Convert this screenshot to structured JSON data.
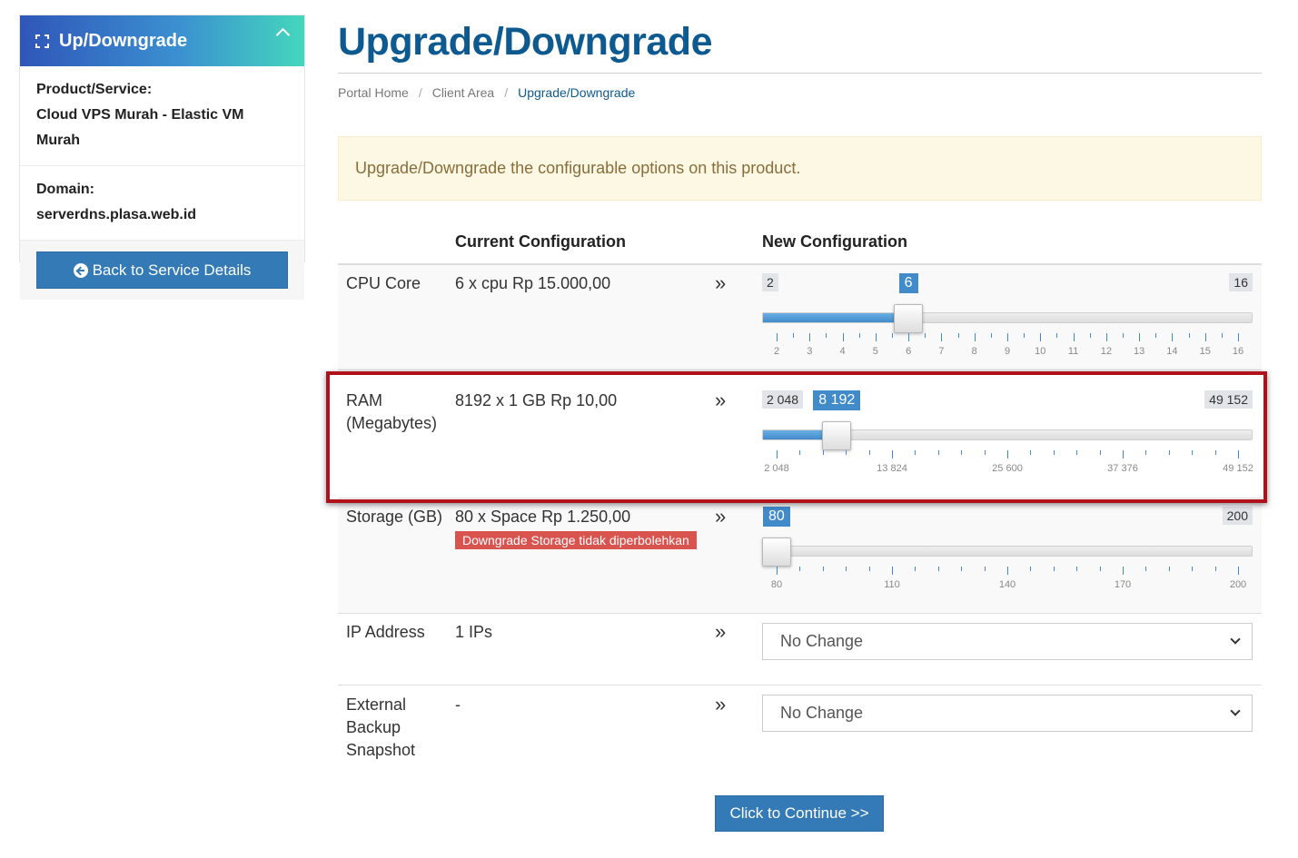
{
  "sidebar": {
    "title": "Up/Downgrade",
    "product_label": "Product/Service:",
    "product_value": "Cloud VPS Murah - Elastic VM Murah",
    "domain_label": "Domain:",
    "domain_value": "serverdns.plasa.web.id",
    "back_button": "Back to Service Details"
  },
  "page": {
    "title": "Upgrade/Downgrade",
    "breadcrumb": [
      "Portal Home",
      "Client Area",
      "Upgrade/Downgrade"
    ],
    "breadcrumb_sep": "/",
    "alert": "Upgrade/Downgrade the configurable options on this product."
  },
  "table": {
    "head_current": "Current Configuration",
    "head_new": "New Configuration",
    "arrow": "»",
    "rows": [
      {
        "label": "CPU Core",
        "current": "6 x cpu Rp 15.000,00",
        "min": "2",
        "max": "16",
        "value": "6",
        "min_num": 2,
        "max_num": 16,
        "value_num": 6,
        "tick_labels": [
          "2",
          "3",
          "4",
          "5",
          "6",
          "7",
          "8",
          "9",
          "10",
          "11",
          "12",
          "13",
          "14",
          "15",
          "16"
        ]
      },
      {
        "label": "RAM (Megabytes)",
        "current": "8192 x 1 GB Rp 10,00",
        "min": "2 048",
        "max": "49 152",
        "value": "8 192",
        "min_num": 2048,
        "max_num": 49152,
        "value_num": 8192,
        "tick_labels": [
          "2 048",
          "13 824",
          "25 600",
          "37 376",
          "49 152"
        ]
      },
      {
        "label": "Storage (GB)",
        "current": "80 x Space Rp 1.250,00",
        "warning": "Downgrade Storage tidak diperbolehkan",
        "max": "200",
        "value": "80",
        "min_num": 80,
        "max_num": 200,
        "value_num": 80,
        "tick_labels": [
          "80",
          "110",
          "140",
          "170",
          "200"
        ]
      },
      {
        "label": "IP Address",
        "current": "1 IPs",
        "select": "No Change"
      },
      {
        "label": "External Backup Snapshot",
        "current": "-",
        "select": "No Change"
      }
    ]
  },
  "continue_button": "Click to Continue >>",
  "colors": {
    "brand": "#0d5a91",
    "primary": "#337ab7",
    "danger": "#d9534f",
    "highlight": "#b0121b"
  }
}
